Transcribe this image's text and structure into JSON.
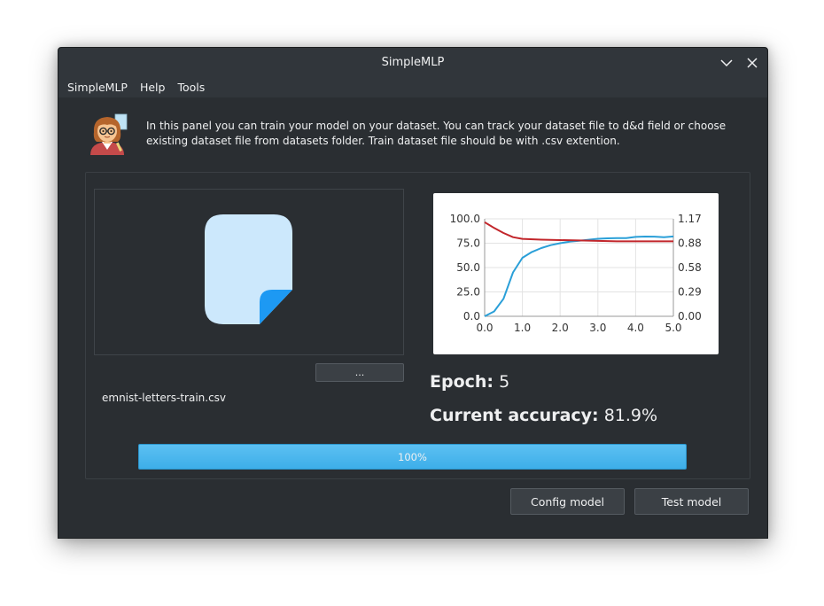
{
  "window": {
    "title": "SimpleMLP"
  },
  "menu": [
    "SimpleMLP",
    "Help",
    "Tools"
  ],
  "info": {
    "icon": "teacher-emoji-icon",
    "text": "In this panel you can train your model on your dataset. You can track your dataset file to d&d field or choose existing dataset file from datasets folder. Train dataset file should be with .csv extention."
  },
  "dataset": {
    "file_icon": "file-icon",
    "browse_label": "...",
    "filename": "emnist-letters-train.csv"
  },
  "stats": {
    "epoch_label": "Epoch:",
    "epoch_value": "5",
    "accuracy_label": "Current accuracy:",
    "accuracy_value": "81.9%"
  },
  "progress": {
    "value": 100,
    "label": "100%"
  },
  "buttons": {
    "config": "Config model",
    "test": "Test model"
  },
  "colors": {
    "accuracy": "#2a9fd8",
    "error": "#c2262b",
    "progress": "#3daee9"
  },
  "chart_data": {
    "type": "line",
    "x_ticks": [
      "0.0",
      "1.0",
      "2.0",
      "3.0",
      "4.0",
      "5.0"
    ],
    "y_left_ticks": [
      "0.0",
      "25.0",
      "50.0",
      "75.0",
      "100.0"
    ],
    "y_right_ticks": [
      "0.00",
      "0.29",
      "0.58",
      "0.88",
      "1.17"
    ],
    "xlim": [
      0,
      5
    ],
    "ylim_left": [
      0,
      100
    ],
    "ylim_right": [
      0,
      1.17
    ],
    "grid": true,
    "series": [
      {
        "axis": "left",
        "color": "#2a9fd8",
        "x": [
          0,
          0.25,
          0.5,
          0.75,
          1.0,
          1.25,
          1.5,
          1.75,
          2.0,
          2.25,
          2.5,
          2.75,
          3.0,
          3.25,
          3.5,
          3.75,
          4.0,
          4.25,
          4.5,
          4.75,
          5.0
        ],
        "y": [
          0,
          5,
          18,
          45,
          60,
          66,
          70,
          73,
          75,
          76.5,
          77.5,
          78.5,
          79.5,
          80,
          80.2,
          80.3,
          81.5,
          81.8,
          81.7,
          81.2,
          81.9
        ]
      },
      {
        "axis": "right",
        "color": "#c2262b",
        "x": [
          0,
          0.25,
          0.5,
          0.75,
          1.0,
          1.5,
          2.0,
          2.5,
          3.0,
          3.5,
          4.0,
          4.5,
          5.0
        ],
        "y": [
          1.13,
          1.06,
          1.0,
          0.95,
          0.93,
          0.92,
          0.915,
          0.91,
          0.905,
          0.9,
          0.9,
          0.9,
          0.9
        ]
      }
    ]
  }
}
